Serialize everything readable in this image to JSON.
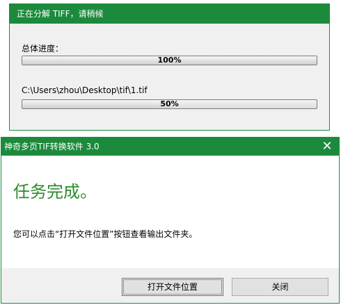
{
  "progress_window": {
    "title": "正在分解 TIFF，请稍候",
    "overall_label": "总体进度：",
    "overall_percent_text": "100%",
    "overall_fraction": 1.0,
    "file_path": "C:\\Users\\zhou\\Desktop\\tif\\1.tif",
    "file_percent_text": "50%",
    "file_fraction": 0.5
  },
  "dialog": {
    "title": "神奇多页TIF转换软件 3.0",
    "close_glyph": "✕",
    "heading": "任务完成。",
    "message": "您可以点击“打开文件位置”按钮查看输出文件夹。",
    "open_location_label": "打开文件位置",
    "close_label": "关闭"
  },
  "colors": {
    "titlebar": "#1b8a3c",
    "heading": "#2b8a2b"
  }
}
